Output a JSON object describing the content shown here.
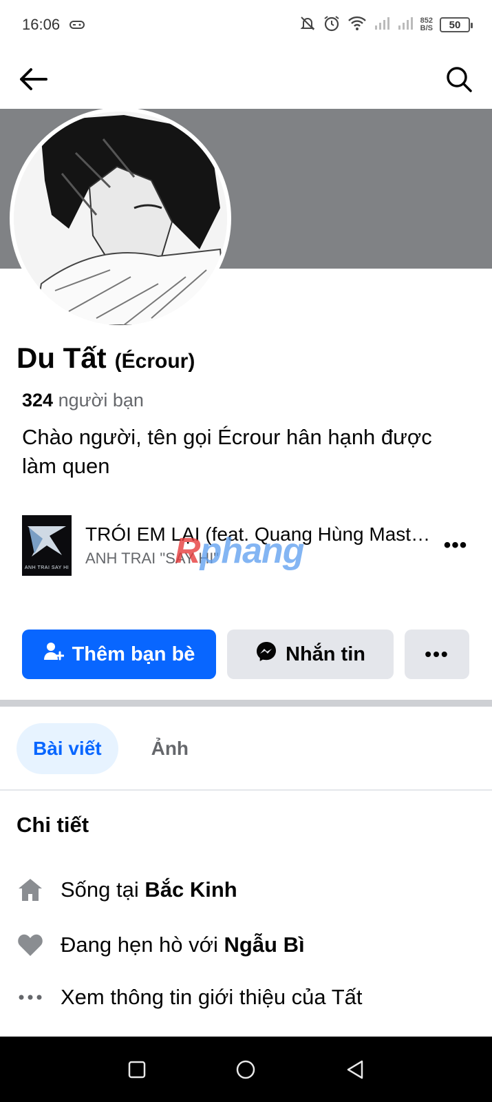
{
  "status_bar": {
    "time": "16:06",
    "net_speed_value": "852",
    "net_speed_unit": "B/S",
    "battery": "50"
  },
  "header": {
    "back_icon": "arrow-left-icon",
    "search_icon": "search-icon"
  },
  "profile": {
    "name": "Du Tất",
    "alternate_name": "(Écrour)",
    "friends_count": "324",
    "friends_label": "người bạn",
    "bio": "Chào người, tên gọi Écrour hân hạnh được làm quen"
  },
  "music": {
    "album_text": "ANH TRAI SAY HI",
    "title": "TRÓI EM LẠI (feat. Quang Hùng MasterD)",
    "artist": "ANH TRAI \"SAY HI\"",
    "more_label": "•••"
  },
  "watermark": {
    "first_letter": "R",
    "rest": "phang"
  },
  "actions": {
    "add_friend": "Thêm bạn bè",
    "message": "Nhắn tin",
    "more": "•••"
  },
  "tabs": [
    {
      "label": "Bài viết",
      "active": true
    },
    {
      "label": "Ảnh",
      "active": false
    }
  ],
  "details": {
    "title": "Chi tiết",
    "lives_prefix": "Sống tại ",
    "lives_value": "Bắc Kinh",
    "relationship_prefix": "Đang hẹn hò với ",
    "relationship_value": "Ngẫu Bì",
    "see_more": "Xem thông tin giới thiệu của Tất"
  },
  "colors": {
    "primary": "#0866ff",
    "secondary_bg": "#e4e6eb",
    "cover": "#808285",
    "muted_text": "#65676b"
  }
}
